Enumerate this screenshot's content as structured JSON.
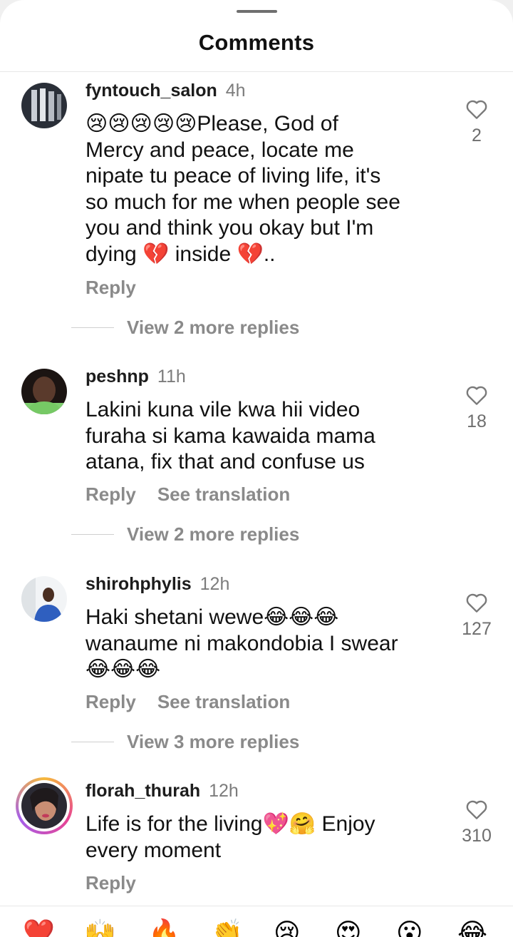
{
  "sheet": {
    "title": "Comments"
  },
  "comments": [
    {
      "username": "fyntouch_salon",
      "time": "4h",
      "text_lines": [
        "😢😢😢😢😢Please, God of",
        "Mercy and peace, locate me",
        "nipate tu peace of living life, it's",
        "so much for me when people see",
        "you and think you okay but I'm",
        "dying 💔 inside 💔.."
      ],
      "reply_label": "Reply",
      "likes": "2",
      "replies_label": "View 2 more replies"
    },
    {
      "username": "peshnp",
      "time": "11h",
      "text_lines": [
        "Lakini kuna vile kwa hii video",
        "furaha si kama kawaida mama",
        "atana, fix that and confuse us"
      ],
      "reply_label": "Reply",
      "translate_label": "See translation",
      "likes": "18",
      "replies_label": "View 2 more replies"
    },
    {
      "username": "shirohphylis",
      "time": "12h",
      "text_lines": [
        "Haki shetani wewe😂😂😂",
        "wanaume ni makondobia I swear",
        "😂😂😂"
      ],
      "reply_label": "Reply",
      "translate_label": "See translation",
      "likes": "127",
      "replies_label": "View 3 more replies"
    },
    {
      "username": "florah_thurah",
      "time": "12h",
      "text_lines": [
        "Life is for the living💖🤗 Enjoy",
        "every moment"
      ],
      "reply_label": "Reply",
      "likes": "310"
    }
  ],
  "reactions": [
    "❤️",
    "🙌",
    "🔥",
    "👏",
    "😢",
    "😍",
    "😮",
    "😂"
  ],
  "icons": {
    "like": "heart-outline-icon"
  },
  "colors": {
    "muted": "#8a8a8a",
    "text": "#111111"
  }
}
